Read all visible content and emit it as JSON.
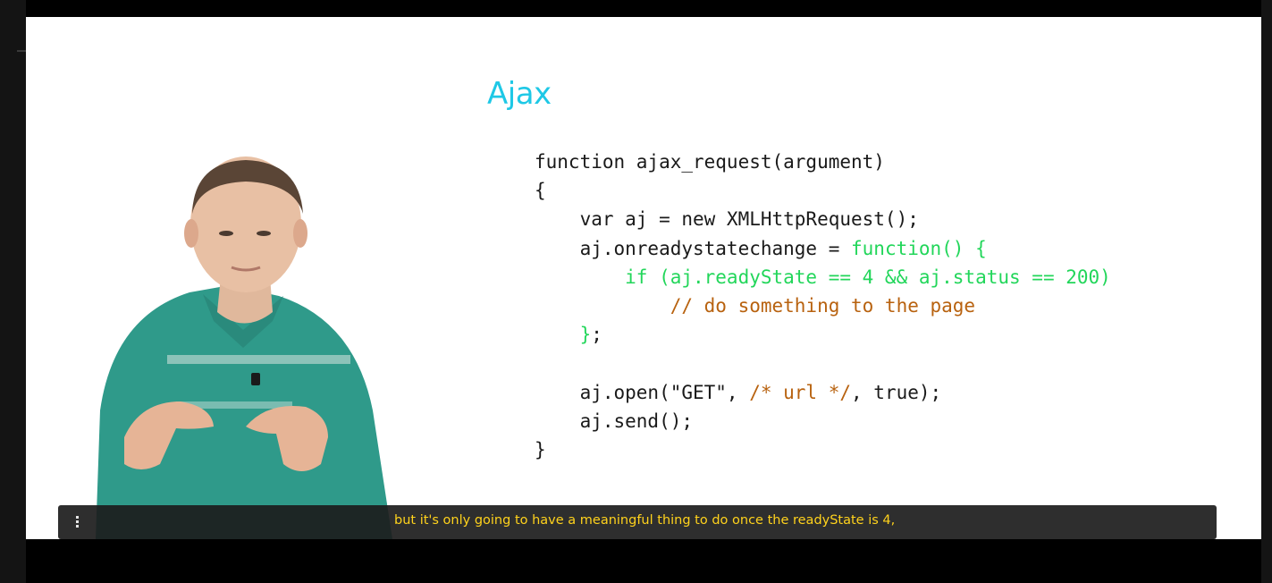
{
  "slide": {
    "title": "Ajax",
    "code_lines": [
      {
        "segments": [
          {
            "text": "function ajax_request(argument)",
            "style": "plain"
          }
        ]
      },
      {
        "segments": [
          {
            "text": "{",
            "style": "plain"
          }
        ]
      },
      {
        "segments": [
          {
            "text": "    var aj = new XMLHttpRequest();",
            "style": "plain"
          }
        ]
      },
      {
        "segments": [
          {
            "text": "    aj.onreadystatechange = ",
            "style": "plain"
          },
          {
            "text": "function() {",
            "style": "green"
          }
        ]
      },
      {
        "segments": [
          {
            "text": "        if (aj.readyState == 4 && aj.status == 200)",
            "style": "green"
          }
        ]
      },
      {
        "segments": [
          {
            "text": "            // do something to the page",
            "style": "orange"
          }
        ]
      },
      {
        "segments": [
          {
            "text": "    }",
            "style": "green"
          },
          {
            "text": ";",
            "style": "plain"
          }
        ]
      },
      {
        "segments": [
          {
            "text": "",
            "style": "plain"
          }
        ]
      },
      {
        "segments": [
          {
            "text": "    aj.open(\"GET\", ",
            "style": "plain"
          },
          {
            "text": "/* url */",
            "style": "orange"
          },
          {
            "text": ", true);",
            "style": "plain"
          }
        ]
      },
      {
        "segments": [
          {
            "text": "    aj.send();",
            "style": "plain"
          }
        ]
      },
      {
        "segments": [
          {
            "text": "}",
            "style": "plain"
          }
        ]
      }
    ]
  },
  "player": {
    "caption": "but it's only going to have a meaningful thing to do once the readyState is 4,",
    "caption_menu_icon": "vertical-dots-icon"
  },
  "colors": {
    "title": "#1ec8e6",
    "code_keyword_green": "#22d65a",
    "code_comment_orange": "#b8620f",
    "caption_text": "#ffd21c"
  }
}
